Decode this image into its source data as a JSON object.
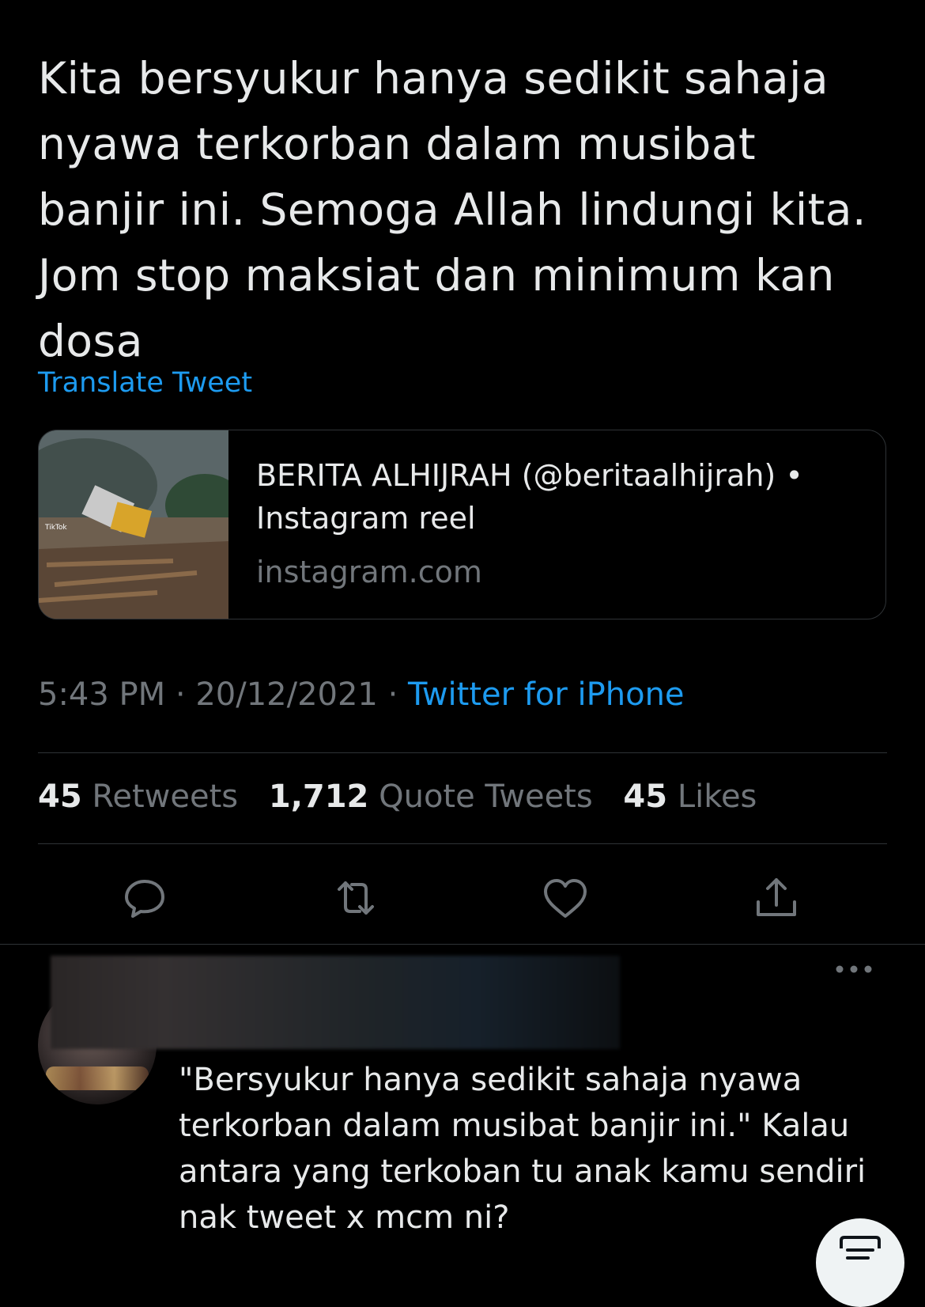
{
  "tweet": {
    "text": "Kita bersyukur hanya sedikit sahaja nyawa terkorban dalam musibat banjir ini. Semoga Allah lindungi kita. Jom stop maksiat dan minimum kan dosa",
    "translate_label": "Translate Tweet",
    "card": {
      "title": "BERITA ALHIJRAH (@beritaalhijrah) • Instagram reel",
      "domain": "instagram.com",
      "thumb_watermark": "TikTok"
    },
    "time": "5:43 PM",
    "date": "20/12/2021",
    "separator": "·",
    "source": "Twitter for iPhone",
    "stats": {
      "retweets_count": "45",
      "retweets_label": "Retweets",
      "quotes_count": "1,712",
      "quotes_label": "Quote Tweets",
      "likes_count": "45",
      "likes_label": "Likes"
    },
    "actions": [
      "reply-icon",
      "retweet-icon",
      "like-icon",
      "share-icon"
    ]
  },
  "reply": {
    "text": "\"Bersyukur hanya sedikit sahaja nyawa terkorban dalam musibat banjir ini.\" Kalau antara yang terkoban tu anak kamu sendiri nak tweet x mcm ni?",
    "more_icon": "more-icon"
  },
  "colors": {
    "background": "#000000",
    "text": "#e7e9ea",
    "secondary": "#71767b",
    "accent": "#1d9bf0",
    "border": "#2f3336"
  }
}
